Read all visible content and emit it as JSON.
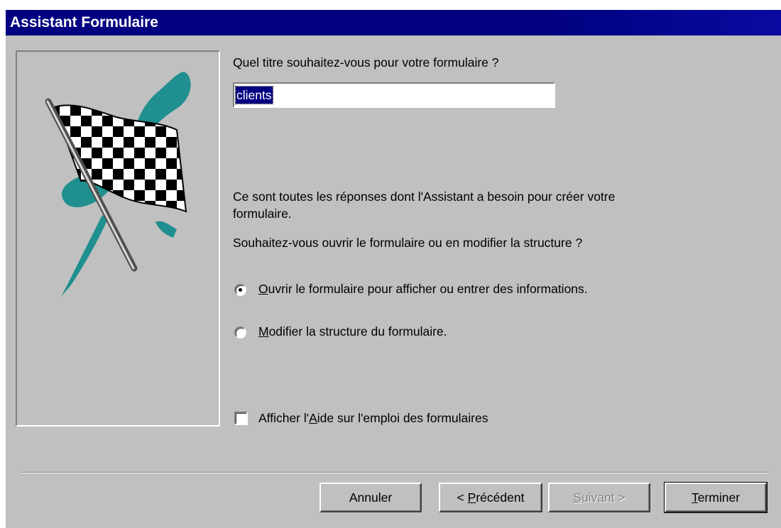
{
  "window": {
    "title": "Assistant Formulaire"
  },
  "form": {
    "title_question": "Quel titre souhaitez-vous pour votre formulaire ?",
    "title_value": "clients",
    "info_line1": "Ce sont toutes les réponses dont l'Assistant a besoin pour créer votre",
    "info_line2": "formulaire.",
    "open_question": "Souhaitez-vous ouvrir le formulaire ou en modifier la structure ?",
    "options": [
      {
        "hotkey": "O",
        "rest": "uvrir le formulaire pour afficher ou entrer des informations.",
        "selected": true
      },
      {
        "hotkey": "M",
        "rest": "odifier la structure du formulaire.",
        "selected": false
      }
    ],
    "help_checkbox": {
      "before": "Afficher l'",
      "hotkey": "A",
      "after": "ide sur l'emploi des formulaires",
      "checked": false
    }
  },
  "buttons": {
    "cancel": "Annuler",
    "previous": {
      "before": "< ",
      "hotkey": "P",
      "after": "récédent"
    },
    "next": {
      "hotkey": "S",
      "after": "uivant >",
      "enabled": false
    },
    "finish": {
      "hotkey": "T",
      "after": "erminer"
    }
  },
  "colors": {
    "titlebar": "#000080",
    "face": "#c0c0c0",
    "flag_swash": "#1f8f8f"
  },
  "icons": {
    "illustration": "checkered-flag-icon"
  }
}
